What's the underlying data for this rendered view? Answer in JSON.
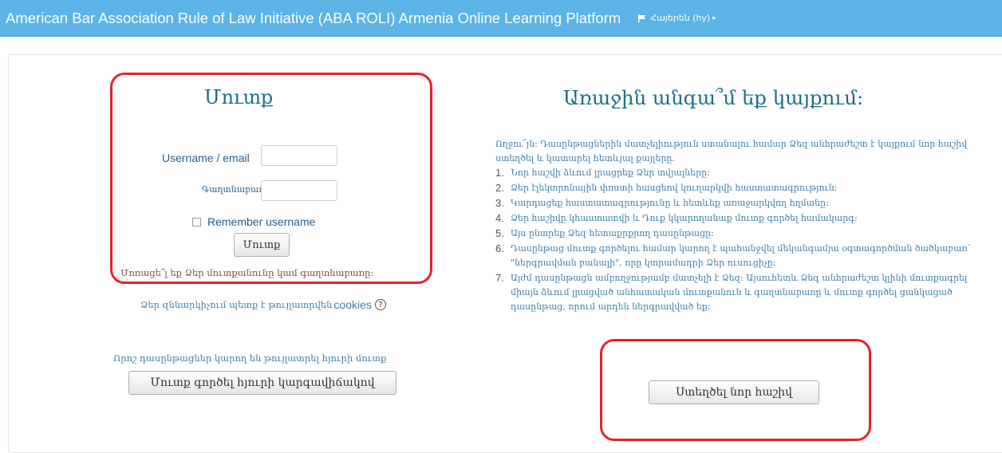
{
  "navbar": {
    "title": "American Bar Association Rule of Law Initiative (ABA ROLI) Armenia Online Learning Platform",
    "language": "Հայերեն (hy)",
    "language_icon": "flag-icon",
    "caret": "▸"
  },
  "login": {
    "title": "Մուտք",
    "username_label": "Username / email",
    "password_label": "Գաղտնաբառ",
    "username_value": "",
    "password_value": "",
    "remember_label": "Remember username",
    "remember_checked": false,
    "submit_label": "Մուտք",
    "forgot_text": "Մոռացե՞լ եք Ձեր մուտքանունը կամ գաղտնաբառը։",
    "cookies_text": "Ձեր զննարկիչում պետք է թույլատրվեն",
    "cookies_word": "cookies",
    "help_icon": "?",
    "guest_text": "Որոշ դասընթացներ կարող են թույլատրել հյուրի մուտք",
    "guest_button": "Մուտք գործել հյուրի կարգավիճակով"
  },
  "signup": {
    "title": "Առաջին անգա՞մ եք կայքում:",
    "intro": "Ողջու՜յն: Դասընթացներին մատչելիություն ստանալու համար Ձեզ անհրաժեշտ է կայքում նոր հաշիվ ստեղծել և կատարել հետևյալ քայլերը.",
    "steps": [
      {
        "num": "1.",
        "text": "Նոր հաշվի ձևում լրացրեք Ձեր տվյալները։"
      },
      {
        "num": "2.",
        "text": "Ձեր էլեկտրոնային փոստի հասցեով կուղարկվի հաստատագրություն։"
      },
      {
        "num": "3.",
        "text": "Կարդացեք հաստատագրությունը և հետևեք առաջարկվող հղմանը։"
      },
      {
        "num": "4.",
        "text": "Ձեր հաշիվը կհաստատվի և Դուք կկարողանաք մուտք գործել համակարգ։"
      },
      {
        "num": "5.",
        "text": "Այս ընտրեք Ձեզ հետաքրքրող դասընթացը։"
      },
      {
        "num": "6.",
        "text": "Դասընթաց մուտք գործելու համար կարող է պահանջվել մեկանգամյա օգտագործման ծածկաբառ՝ \"ներգրավման բանալի\", որը կտրամադրի Ձեր ուսուցիչը։"
      },
      {
        "num": "7.",
        "text": "Այժմ դասընթացն ամբողջությամբ մատչելի է Ձեզ։ Այսուհետև Ձեզ անհրաժեշտ կլինի մուտքագրել միայն ձևում լրացված անհատական մուտքանուն և գաղտնաբառը և մուտք գործել ցանկացած դասընթաց, որում արդեն ներգրավված եք։"
      }
    ],
    "create_button": "Ստեղծել նոր հաշիվ"
  },
  "colors": {
    "navbar_bg": "#5bb3e6",
    "highlight": "#e4222b",
    "title": "#1a6d8a",
    "link": "#3e7fa8"
  }
}
